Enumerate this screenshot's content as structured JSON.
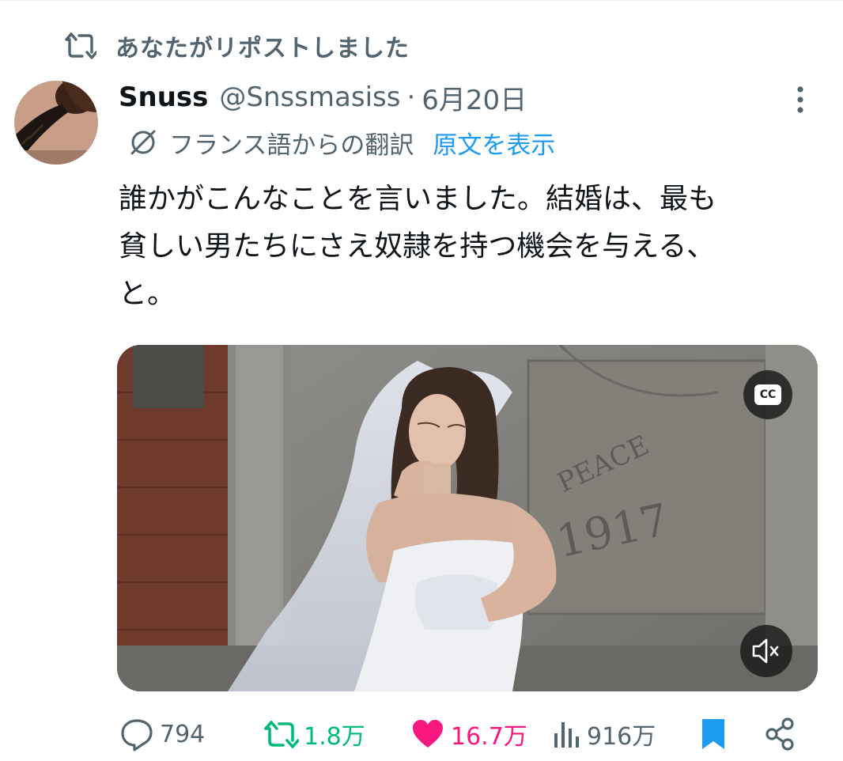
{
  "retweet_banner": {
    "icon": "retweet-icon",
    "text": "あなたがリポストしました"
  },
  "author": {
    "name": "Snuss",
    "handle": "@Snssmasiss",
    "separator": "·",
    "date": "6月20日"
  },
  "translation": {
    "icon": "translate-icon",
    "label": "フランス語からの翻訳",
    "show_original": "原文を表示"
  },
  "tweet": {
    "lines": [
      "誰かがこんなことを言いました。結婚は、最も",
      "貧しい男たちにさえ奴隷を持つ機会を与える、",
      "と。"
    ]
  },
  "media": {
    "type": "video",
    "cc_label": "CC",
    "sign_text_1": "PEACE",
    "sign_text_2": "1917"
  },
  "actions": {
    "replies": "794",
    "reposts": "1.8万",
    "likes": "16.7万",
    "views": "916万"
  },
  "colors": {
    "text": "#0f1419",
    "secondary": "#536471",
    "link": "#1d9bf0",
    "repost_active": "#00ba7c",
    "like_active": "#f91880",
    "bookmark_active": "#1d9bf0"
  }
}
